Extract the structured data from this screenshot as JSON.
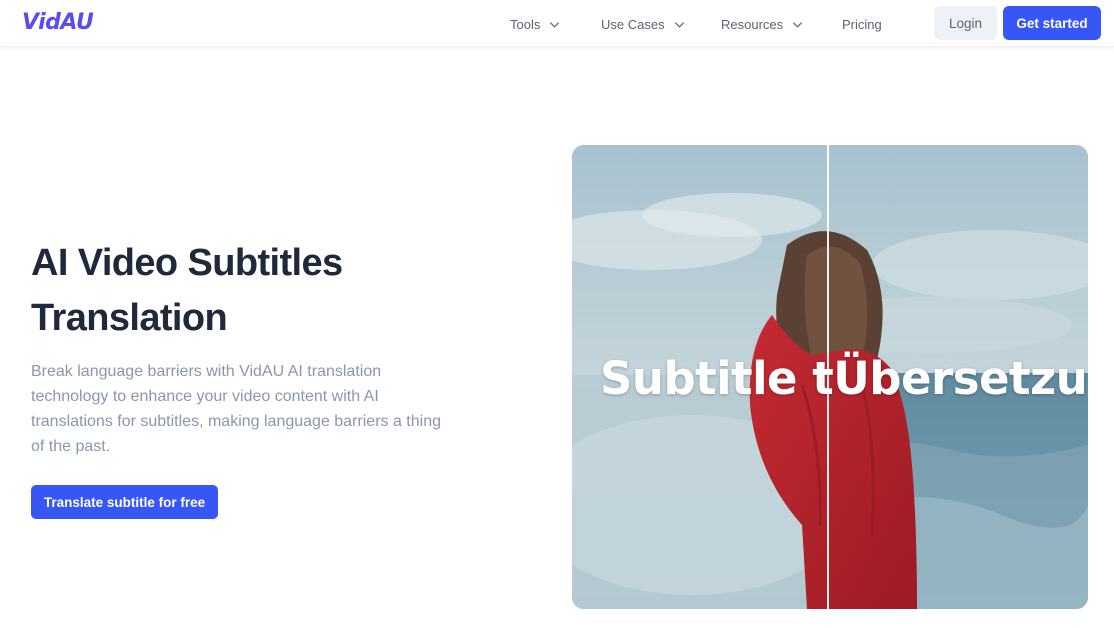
{
  "brand": {
    "logo_text": "VidAU",
    "logo_color": "#5b4cf0"
  },
  "nav": {
    "items": [
      {
        "label": "Tools",
        "has_dropdown": true
      },
      {
        "label": "Use Cases",
        "has_dropdown": true
      },
      {
        "label": "Resources",
        "has_dropdown": true
      },
      {
        "label": "Pricing",
        "has_dropdown": false
      }
    ],
    "login_label": "Login",
    "get_started_label": "Get started"
  },
  "hero": {
    "title_line1": "AI Video Subtitles",
    "title_line2": "Translation",
    "description": "Break language barriers with VidAU AI translation technology to enhance your video content with AI translations for subtitles, making language barriers a thing of the past.",
    "cta_label": "Translate subtitle for free"
  },
  "media": {
    "subtitle_overlay": "Subtitle tÜbersetzung:",
    "icons": [
      "comparison-divider"
    ]
  },
  "colors": {
    "accent": "#3657f5",
    "heading": "#1e293b",
    "muted_text": "#8a97ab",
    "nav_text": "#5b6472",
    "sweater_red": "#b8232c"
  }
}
